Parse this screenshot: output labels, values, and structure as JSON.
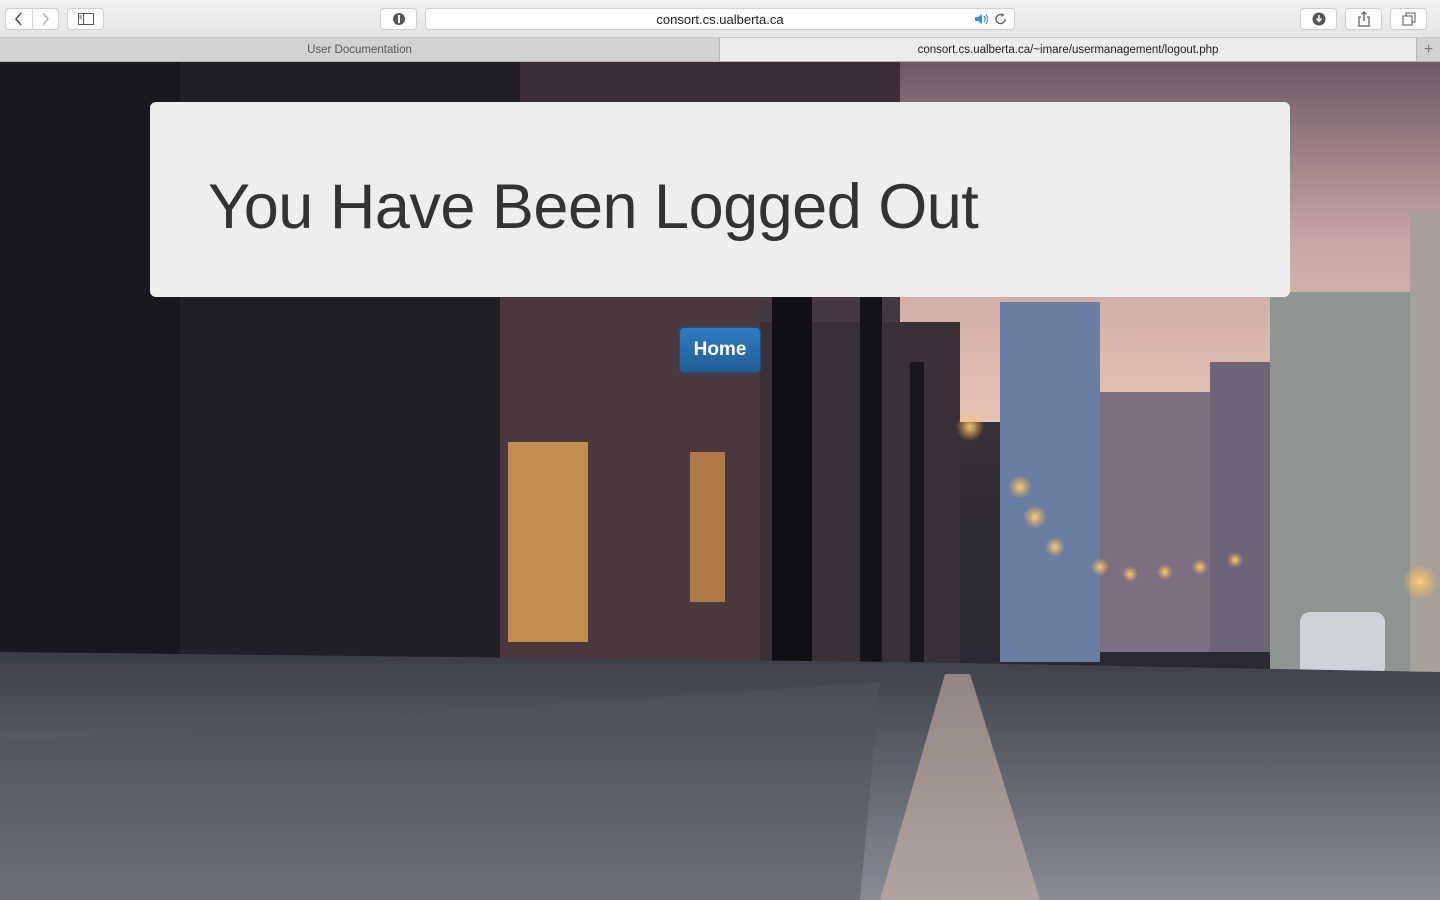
{
  "browser": {
    "url": "consort.cs.ualberta.ca",
    "icons": {
      "back": "chevron-left-icon",
      "forward": "chevron-right-icon",
      "sidebar": "sidebar-icon",
      "privacy": "shield-icon",
      "audio": "speaker-icon",
      "reload": "reload-icon",
      "downloads": "download-icon",
      "share": "share-icon",
      "tabs": "tabs-overview-icon",
      "new_tab": "plus-icon"
    },
    "tabs": [
      {
        "label": "User Documentation",
        "active": false
      },
      {
        "label": "consort.cs.ualberta.ca/~imare/usermanagement/logout.php",
        "active": true
      }
    ],
    "new_tab_glyph": "+"
  },
  "page": {
    "heading": "You Have Been Logged Out",
    "home_button": "Home",
    "colors": {
      "jumbotron_bg": "#eeeeee",
      "heading": "#333333",
      "button_primary": "#2a6fb0"
    }
  }
}
